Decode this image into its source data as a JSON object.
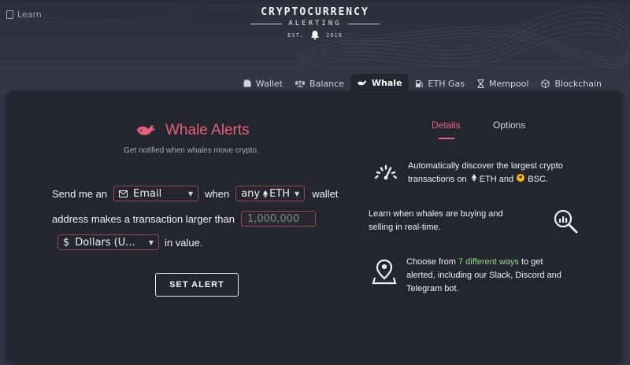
{
  "header": {
    "learn_label": "Learn",
    "brand_line1": "CRYPTOCURRENCY",
    "brand_line2": "ALERTING",
    "brand_est": "EST.",
    "brand_year": "2018"
  },
  "nav": {
    "tabs": [
      {
        "label": "Wallet",
        "icon": "wallet-icon"
      },
      {
        "label": "Balance",
        "icon": "scale-icon"
      },
      {
        "label": "Whale",
        "icon": "whale-icon",
        "active": true
      },
      {
        "label": "ETH Gas",
        "icon": "gas-pump-icon"
      },
      {
        "label": "Mempool",
        "icon": "hourglass-icon"
      },
      {
        "label": "Blockchain",
        "icon": "cube-icon"
      }
    ]
  },
  "alert": {
    "title": "Whale Alerts",
    "subtitle": "Get notified when whales move crypto.",
    "send_me_an": "Send me an",
    "method": "Email",
    "when": "when",
    "asset_prefix": "any",
    "asset": "ETH",
    "wallet": "wallet",
    "address_text": "address makes a transaction larger than",
    "amount_placeholder": "1,000,000",
    "currency_symbol": "$",
    "currency": "Dollars (U...",
    "in_value": "in value.",
    "button": "SET ALERT"
  },
  "info": {
    "tab_details": "Details",
    "tab_options": "Options",
    "feature1_line1": "Automatically discover the largest crypto",
    "feature1_line2_a": "transactions on",
    "feature1_eth": "ETH",
    "feature1_and": "and",
    "feature1_bsc": "BSC.",
    "feature2_line1": "Learn when whales are buying and",
    "feature2_line2": "selling in real-time.",
    "feature3_a": "Choose from",
    "feature3_hl": "7 different ways",
    "feature3_b": "to get",
    "feature3_line2": "alerted, including our Slack, Discord and",
    "feature3_line3": "Telegram bot."
  },
  "colors": {
    "accent": "#e7607a",
    "panel": "#23262e",
    "background": "#30343f",
    "highlight": "#8fd98a"
  }
}
